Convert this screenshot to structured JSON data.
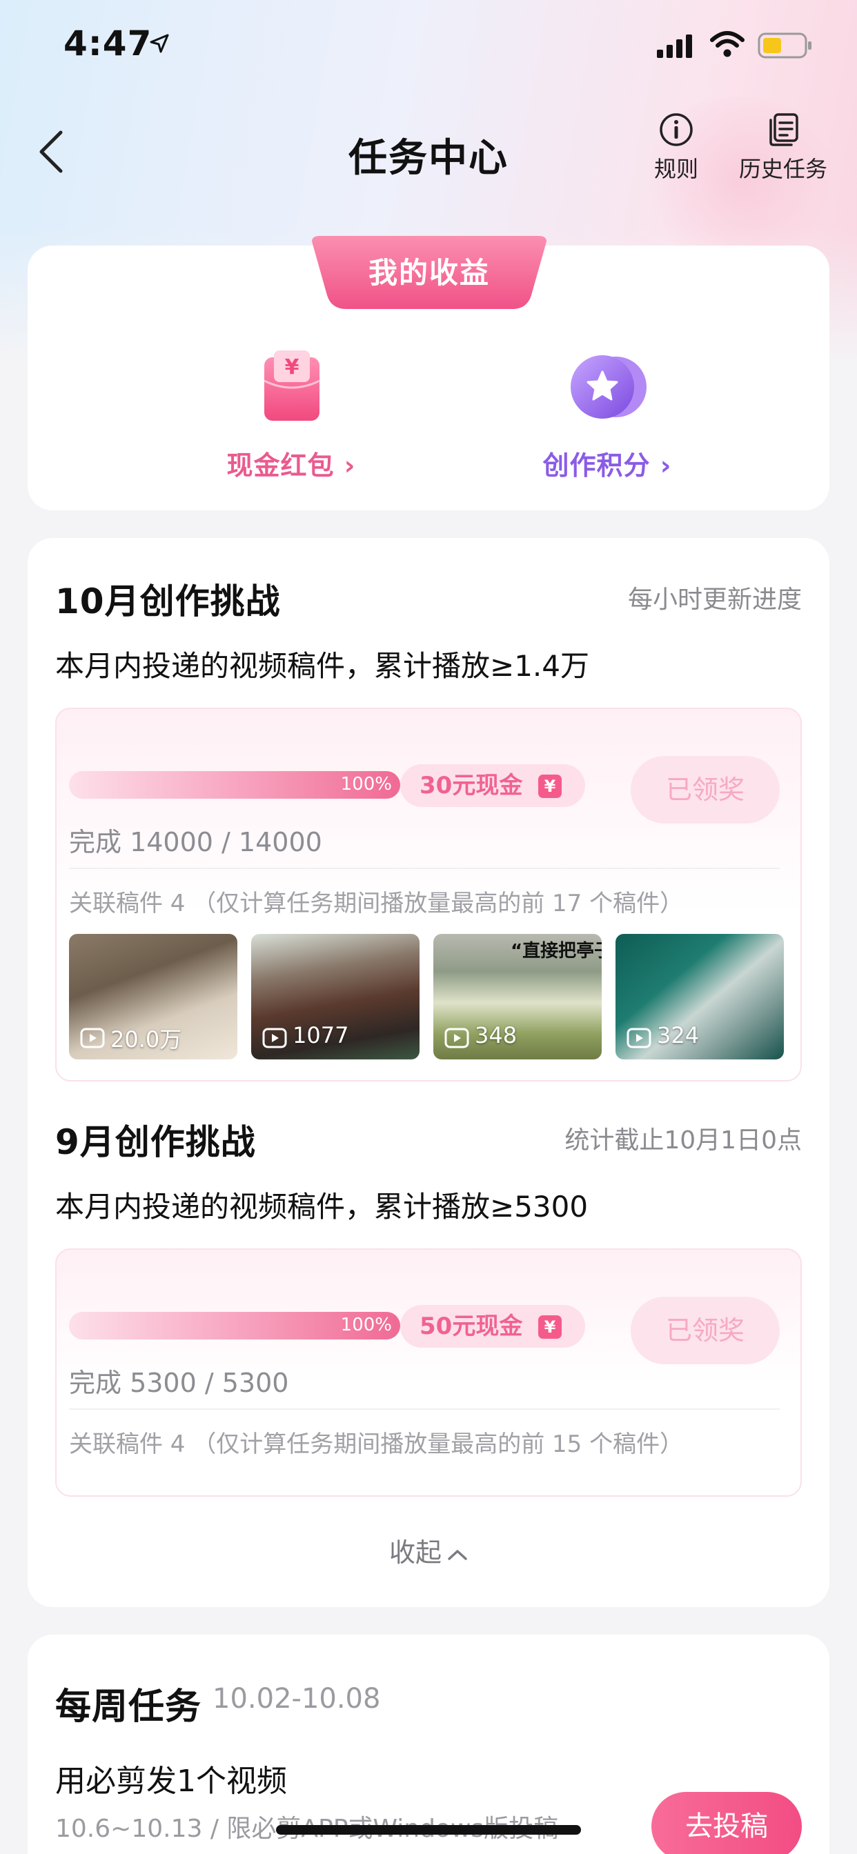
{
  "status_bar": {
    "time": "4:47"
  },
  "nav": {
    "title": "任务中心",
    "rules_label": "规则",
    "history_label": "历史任务"
  },
  "earnings": {
    "tab_label": "我的收益",
    "cash_label": "现金红包 ›",
    "points_label": "创作积分 ›",
    "colors": {
      "cash": "#ea5a8e",
      "points": "#8a5ce6"
    }
  },
  "challenges": [
    {
      "title": "10月创作挑战",
      "note": "每小时更新进度",
      "desc": "本月内投递的视频稿件，累计播放≥1.4万",
      "progress": 1.0,
      "progress_label": "100%",
      "reward": "30元现金",
      "yuan": "¥",
      "claim_label": "已领奖",
      "progress_text": "完成 14000 / 14000",
      "linked_text": "关联稿件 4 （仅计算任务期间播放量最高的前 17 个稿件）",
      "thumbs": [
        {
          "views": "20.0万"
        },
        {
          "views": "1077"
        },
        {
          "views": "348",
          "caption": "“直接把亭子"
        },
        {
          "views": "324"
        }
      ]
    },
    {
      "title": "9月创作挑战",
      "note": "统计截止10月1日0点",
      "desc": "本月内投递的视频稿件，累计播放≥5300",
      "progress": 1.0,
      "progress_label": "100%",
      "reward": "50元现金",
      "yuan": "¥",
      "claim_label": "已领奖",
      "progress_text": "完成 5300 / 5300",
      "linked_text": "关联稿件 4 （仅计算任务期间播放量最高的前 15 个稿件）"
    }
  ],
  "collapse_label": "收起",
  "weekly": {
    "title": "每周任务",
    "range": "10.02-10.08",
    "task_title": "用必剪发1个视频",
    "task_sub": "10.6~10.13 / 限必剪APP或Windows版投稿",
    "go_label": "去投稿"
  },
  "accent_color": "#f24d84"
}
